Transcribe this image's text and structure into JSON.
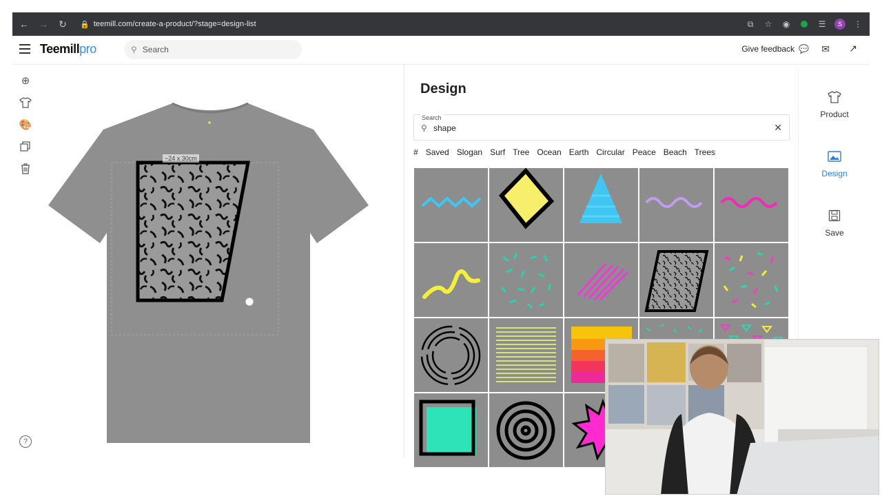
{
  "browser": {
    "url": "teemill.com/create-a-product/?stage=design-list",
    "profile_initial": "S"
  },
  "header": {
    "logo_main": "Teemill",
    "logo_accent": "pro",
    "search_placeholder": "Search",
    "feedback_label": "Give feedback"
  },
  "canvas": {
    "print_size_label": "~24 x 30cm",
    "shirt_color": "#8f8f8f"
  },
  "design_panel": {
    "title": "Design",
    "search_label": "Search",
    "search_value": "shape",
    "tags": [
      "#",
      "Saved",
      "Slogan",
      "Surf",
      "Tree",
      "Ocean",
      "Earth",
      "Circular",
      "Peace",
      "Beach",
      "Trees"
    ],
    "grid_items": [
      {
        "name": "zigzag-blue"
      },
      {
        "name": "diamond-yellow"
      },
      {
        "name": "scribble-cone-blue"
      },
      {
        "name": "wave-lilac"
      },
      {
        "name": "wave-pink"
      },
      {
        "name": "squiggle-yellow"
      },
      {
        "name": "confetti-teal"
      },
      {
        "name": "brush-pink"
      },
      {
        "name": "pattern-parallelogram-black"
      },
      {
        "name": "confetti-multicolor"
      },
      {
        "name": "concentric-circles-black"
      },
      {
        "name": "stripes-lime"
      },
      {
        "name": "stripes-sunset"
      },
      {
        "name": "pattern-mixed"
      },
      {
        "name": "triangles-multicolor"
      },
      {
        "name": "square-teal-frame"
      },
      {
        "name": "target-circles-black"
      },
      {
        "name": "starburst-pink"
      },
      {
        "name": "hidden-4"
      },
      {
        "name": "hidden-5"
      }
    ]
  },
  "right_nav": {
    "items": [
      {
        "label": "Product",
        "icon": "tshirt-icon",
        "active": false
      },
      {
        "label": "Design",
        "icon": "image-icon",
        "active": true
      },
      {
        "label": "Save",
        "icon": "save-icon",
        "active": false
      }
    ]
  },
  "colors": {
    "accent": "#2a7ed8",
    "browser_bar": "#35363a"
  }
}
